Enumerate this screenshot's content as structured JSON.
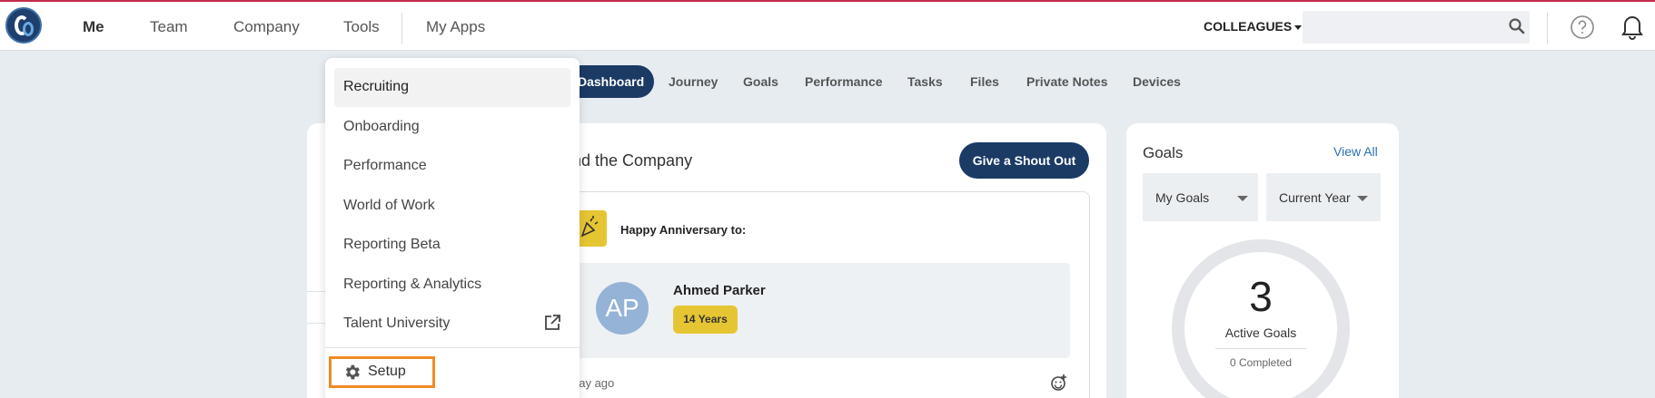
{
  "topnav": {
    "items": [
      "Me",
      "Team",
      "Company",
      "Tools",
      "My Apps"
    ],
    "colleagues_label": "COLLEAGUES",
    "search_value": "",
    "search_placeholder": ""
  },
  "subnav": {
    "active": "Dashboard",
    "items": [
      "Journey",
      "Goals",
      "Performance",
      "Tasks",
      "Files",
      "Private Notes",
      "Devices"
    ]
  },
  "shoutout_card": {
    "title": "nd the Company",
    "button_label": "Give a Shout Out",
    "anniversary_label": "Happy Anniversary to:",
    "person": {
      "initials": "AP",
      "name": "Ahmed Parker",
      "years": "14 Years"
    },
    "time_ago": "day ago"
  },
  "goals_card": {
    "title": "Goals",
    "view_all": "View All",
    "filter_1": "My Goals",
    "filter_2": "Current Year",
    "count": "3",
    "active_label": "Active Goals",
    "completed_label": "0 Completed"
  },
  "tools_menu": {
    "items": [
      "Recruiting",
      "Onboarding",
      "Performance",
      "World of Work",
      "Reporting Beta",
      "Reporting & Analytics",
      "Talent University"
    ],
    "setup_label": "Setup"
  },
  "colors": {
    "brand_navy": "#1b3a64",
    "accent_orange": "#f08a24",
    "badge_yellow": "#e6c533",
    "top_border": "#c42b4b"
  }
}
